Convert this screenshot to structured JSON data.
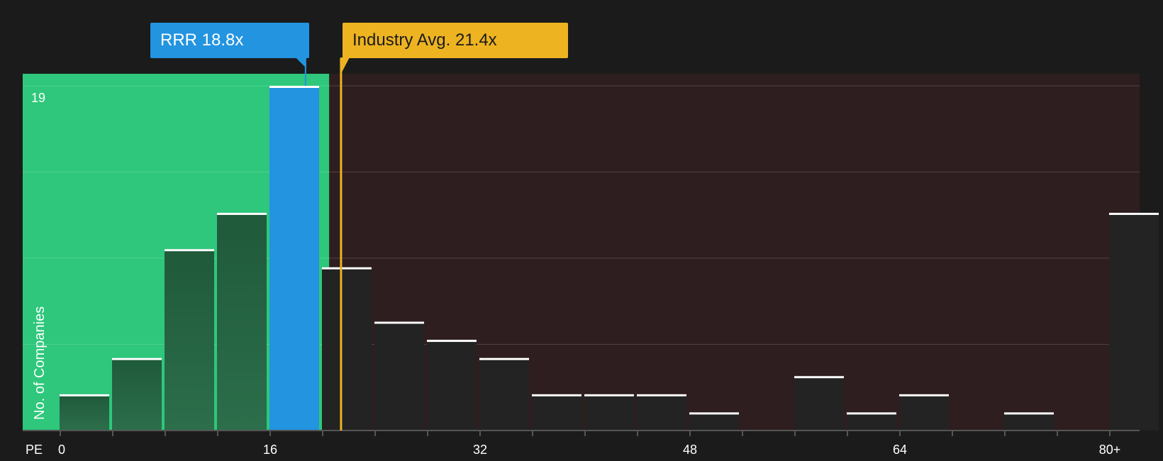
{
  "chart_data": {
    "type": "bar",
    "title": "",
    "xlabel": "PE",
    "ylabel": "No. of Companies",
    "x_ticks": [
      "0",
      "16",
      "32",
      "48",
      "64",
      "80+"
    ],
    "y_ticks": [
      "19"
    ],
    "ylim": [
      0,
      19
    ],
    "xlim": [
      0,
      82
    ],
    "bin_width": 4,
    "bins": [
      {
        "start": 0,
        "value": 2
      },
      {
        "start": 4,
        "value": 4
      },
      {
        "start": 8,
        "value": 10
      },
      {
        "start": 12,
        "value": 12
      },
      {
        "start": 16,
        "value": 19
      },
      {
        "start": 20,
        "value": 9
      },
      {
        "start": 24,
        "value": 6
      },
      {
        "start": 28,
        "value": 5
      },
      {
        "start": 32,
        "value": 4
      },
      {
        "start": 36,
        "value": 2
      },
      {
        "start": 40,
        "value": 2
      },
      {
        "start": 44,
        "value": 2
      },
      {
        "start": 48,
        "value": 1
      },
      {
        "start": 52,
        "value": 0
      },
      {
        "start": 56,
        "value": 3
      },
      {
        "start": 60,
        "value": 1
      },
      {
        "start": 64,
        "value": 2
      },
      {
        "start": 68,
        "value": 0
      },
      {
        "start": 72,
        "value": 1
      },
      {
        "start": 76,
        "value": 0
      },
      {
        "start": 80,
        "value": 12
      }
    ],
    "highlight_bin_start": 16,
    "subject": {
      "label": "RRR 18.8x",
      "value": 18.8
    },
    "industry_avg": {
      "label": "Industry Avg. 21.4x",
      "value": 21.4
    },
    "undervalued_region_end": 20.5,
    "grid": true,
    "colors": {
      "background": "#1b1b1b",
      "green_region": "#2ec77b",
      "red_region": "#2f1e1f",
      "subject": "#2394e0",
      "industry": "#edb321",
      "bar_dark": "#232323",
      "bar_green": "#1f5a3a",
      "cap": "#ffffff"
    }
  }
}
